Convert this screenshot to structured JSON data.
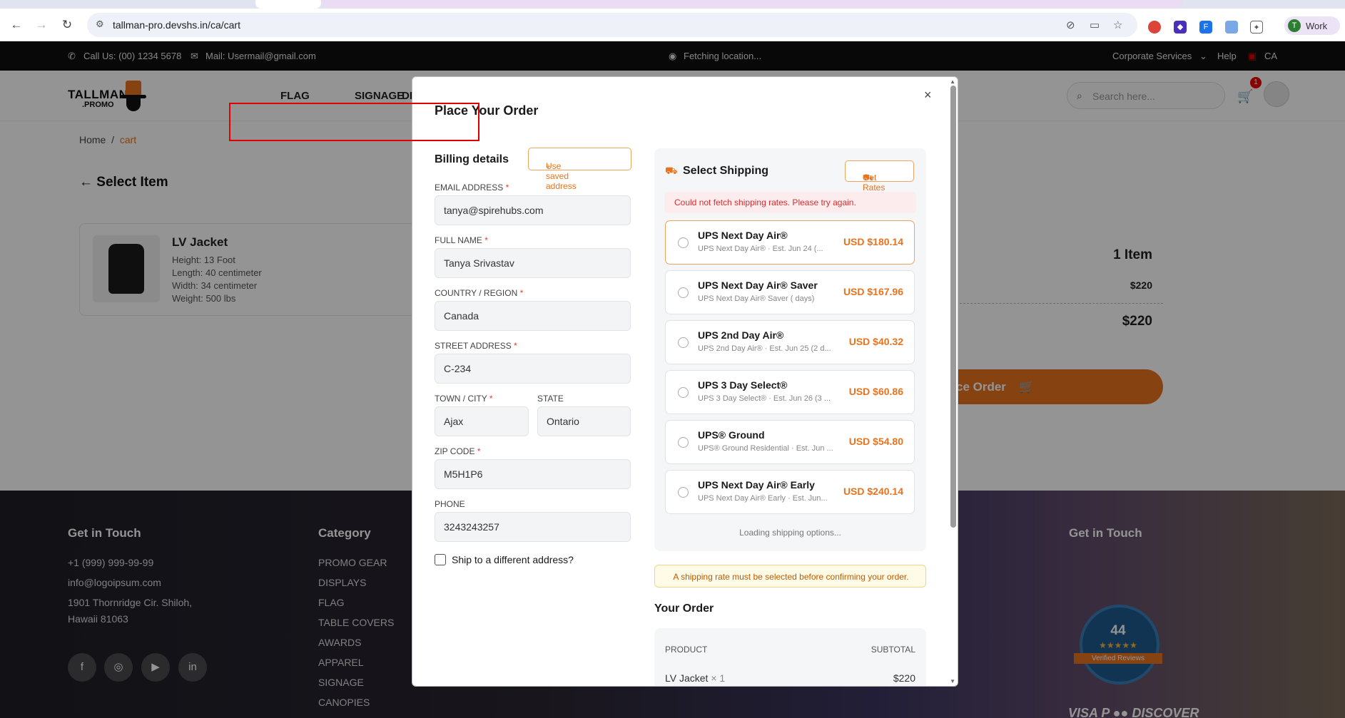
{
  "browser": {
    "url": "tallman-pro.devshs.in/ca/cart",
    "profile_initial": "T",
    "profile_label": "Work"
  },
  "topbar": {
    "call": "Call Us: (00) 1234 5678",
    "mail": "Mail: Usermail@gmail.com",
    "location": "Fetching location...",
    "corporate": "Corporate Services",
    "help": "Help",
    "country": "CA"
  },
  "header": {
    "logo_line1": "TALLMAN",
    "logo_line2": ".PROMO",
    "menu": [
      "FLAG",
      "SIGNAGE",
      "DI"
    ],
    "search_placeholder": "Search here...",
    "cart_count": "1"
  },
  "breadcrumb": {
    "home": "Home",
    "sep": "/",
    "current": "cart"
  },
  "page": {
    "select_item": "Select Item",
    "item": {
      "name": "LV Jacket",
      "specs": [
        "Height: 13 Foot",
        "Length: 40 centimeter",
        "Width: 34 centimeter",
        "Weight: 500 lbs"
      ]
    },
    "summary": {
      "items": "1 Item",
      "subtotal": "$220",
      "total": "$220"
    },
    "place_order": "ce Order"
  },
  "footer": {
    "contact_title": "Get in Touch",
    "phone": "+1 (999) 999-99-99",
    "email": "info@logoipsum.com",
    "address1": "1901 Thornridge Cir. Shiloh,",
    "address2": "Hawaii 81063",
    "category_title": "Category",
    "categories": [
      "PROMO GEAR",
      "DISPLAYS",
      "FLAG",
      "TABLE COVERS",
      "AWARDS",
      "APPAREL",
      "SIGNAGE",
      "CANOPIES"
    ],
    "right_title": "Get in Touch",
    "badge_number": "44",
    "badge_stars": "★★★★★",
    "badge_ribbon": "Verified Reviews",
    "payments": "VISA  P  ●●  DISCOVER"
  },
  "modal": {
    "title": "Place Your Order",
    "close": "×",
    "billing": {
      "title": "Billing details",
      "saved_button": "Use saved address",
      "email_label": "EMAIL ADDRESS",
      "email": "tanya@spirehubs.com",
      "name_label": "FULL NAME",
      "name": "Tanya Srivastav",
      "country_label": "COUNTRY / REGION",
      "country": "Canada",
      "street_label": "STREET ADDRESS",
      "street": "C-234",
      "town_label": "TOWN / CITY",
      "town": "Ajax",
      "state_label": "STATE",
      "state": "Ontario",
      "zip_label": "ZIP CODE",
      "zip": "M5H1P6",
      "phone_label": "PHONE",
      "phone": "3243243257",
      "ship_different": "Ship to a different address?"
    },
    "shipping": {
      "title": "Select Shipping",
      "get_rates": "Get Rates",
      "error": "Could not fetch shipping rates. Please try again.",
      "options": [
        {
          "name": "UPS Next Day Air®",
          "sub": "UPS Next Day Air® · Est. Jun 24 (...",
          "price": "USD $180.14"
        },
        {
          "name": "UPS Next Day Air® Saver",
          "sub": "UPS Next Day Air® Saver ( days)",
          "price": "USD $167.96"
        },
        {
          "name": "UPS 2nd Day Air®",
          "sub": "UPS 2nd Day Air® · Est. Jun 25 (2 d...",
          "price": "USD $40.32"
        },
        {
          "name": "UPS 3 Day Select®",
          "sub": "UPS 3 Day Select® · Est. Jun 26 (3 ...",
          "price": "USD $60.86"
        },
        {
          "name": "UPS® Ground",
          "sub": "UPS® Ground Residential · Est. Jun ...",
          "price": "USD $54.80"
        },
        {
          "name": "UPS Next Day Air® Early",
          "sub": "UPS Next Day Air® Early · Est. Jun...",
          "price": "USD $240.14"
        }
      ],
      "loading": "Loading shipping options..."
    },
    "warning": "A shipping rate must be selected before confirming your order.",
    "your_order": {
      "title": "Your Order",
      "col_product": "PRODUCT",
      "col_subtotal": "SUBTOTAL",
      "product": "LV Jacket",
      "qty": "× 1",
      "subtotal": "$220"
    }
  },
  "colors": {
    "accent": "#e8731e",
    "error": "#d32f2f",
    "highlight": "#e00000"
  }
}
